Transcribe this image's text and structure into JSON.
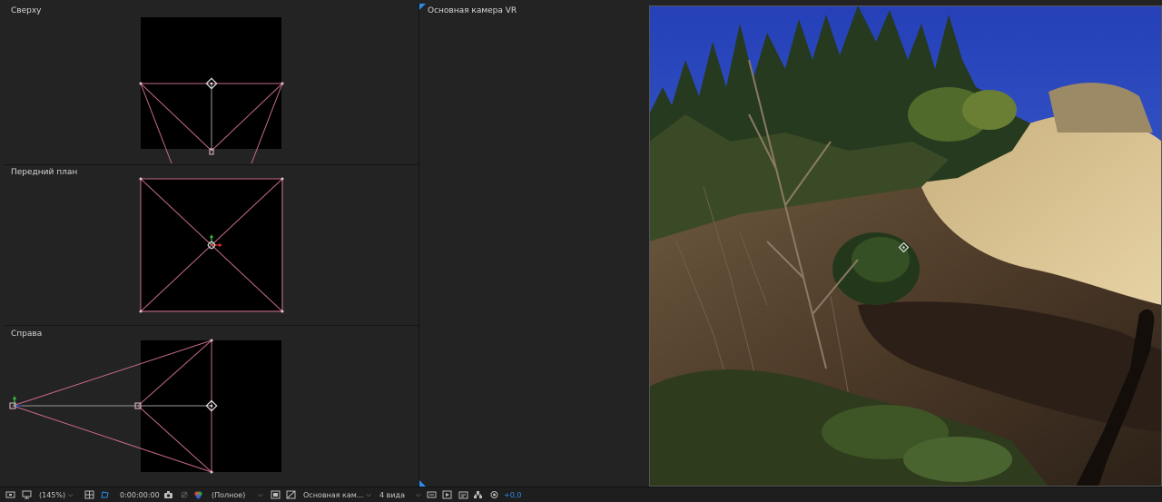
{
  "views": {
    "top": {
      "label": "Сверху"
    },
    "front": {
      "label": "Передний план"
    },
    "right": {
      "label": "Справа"
    },
    "camera": {
      "label": "Основная камера VR"
    }
  },
  "toolbar": {
    "magnification": "(145%)",
    "timecode": "0:00:00:00",
    "resolution": "(Полное)",
    "active_camera": "Основная кам...",
    "view_layout": "4 вида",
    "exposure": "+0,0"
  },
  "colors": {
    "camera_lines": "#c86a8e",
    "accent_blue": "#2d8ceb",
    "panel_bg": "#232323"
  }
}
